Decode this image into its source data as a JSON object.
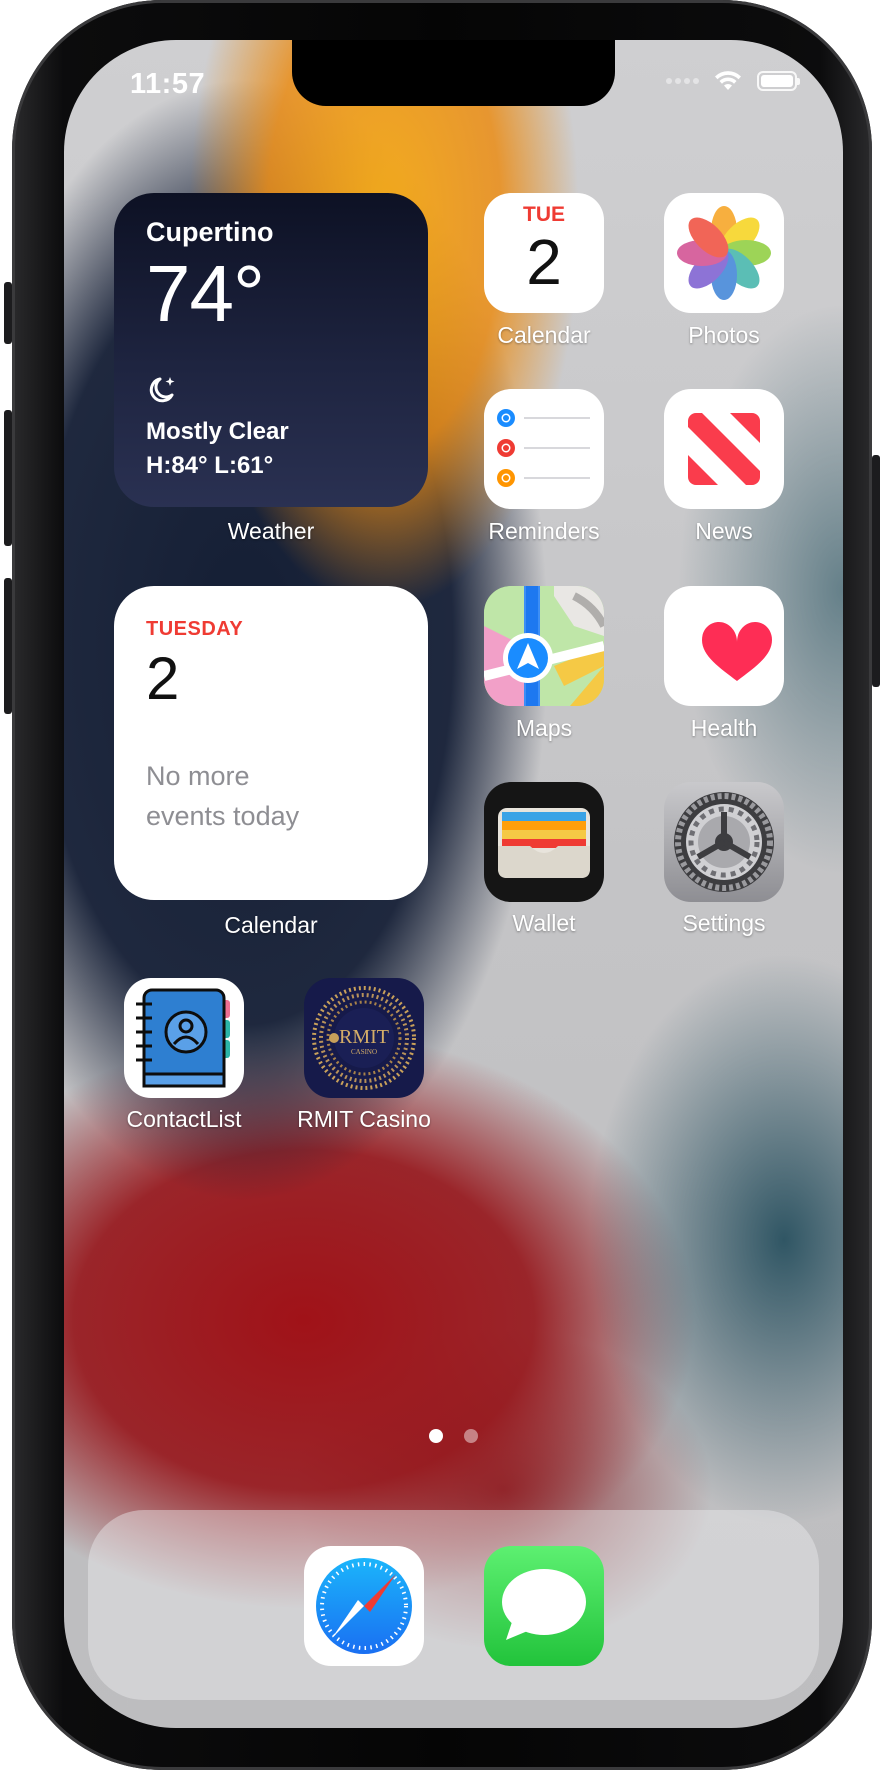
{
  "status_bar": {
    "time": "11:57"
  },
  "weather_widget": {
    "city": "Cupertino",
    "temperature": "74°",
    "condition_icon": "moon-stars-icon",
    "condition": "Mostly Clear",
    "high_low": "H:84° L:61°",
    "label": "Weather"
  },
  "calendar_widget": {
    "day": "TUESDAY",
    "date": "2",
    "events_line1": "No more",
    "events_line2": "events today",
    "label": "Calendar"
  },
  "apps": {
    "calendar": {
      "label": "Calendar",
      "day": "TUE",
      "date": "2"
    },
    "photos": {
      "label": "Photos"
    },
    "reminders": {
      "label": "Reminders"
    },
    "news": {
      "label": "News"
    },
    "maps": {
      "label": "Maps"
    },
    "health": {
      "label": "Health"
    },
    "wallet": {
      "label": "Wallet"
    },
    "settings": {
      "label": "Settings"
    },
    "contactlist": {
      "label": "ContactList"
    },
    "rmit_casino": {
      "label": "RMIT Casino",
      "logo_text": "RMIT",
      "logo_subtext": "CASINO"
    }
  },
  "page_indicator": {
    "pages": 2,
    "current": 1
  },
  "dock": {
    "apps": [
      {
        "name": "safari",
        "icon": "safari-compass-icon"
      },
      {
        "name": "messages",
        "icon": "speech-bubble-icon"
      }
    ]
  },
  "colors": {
    "accent_red": "#ef3b33",
    "weather_bg": "#1e2440",
    "messages_green": "#34c759",
    "safari_blue": "#1a8cff"
  }
}
